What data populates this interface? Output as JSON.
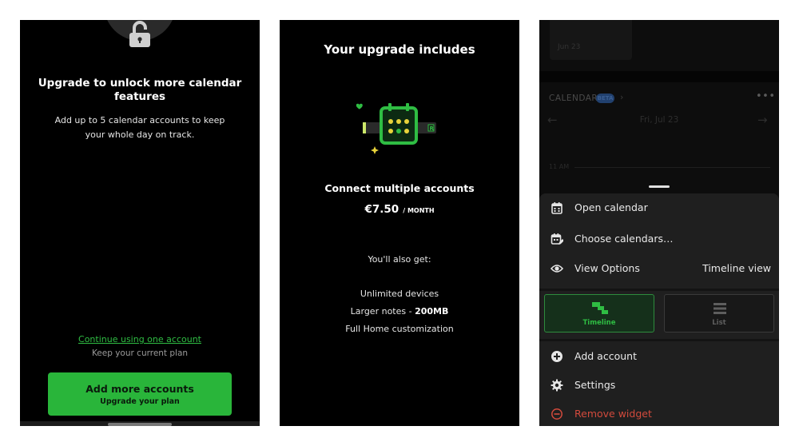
{
  "upgrade_screen": {
    "title": "Upgrade to unlock more calendar features",
    "subtitle": "Add up to 5 calendar accounts to keep your whole day on track.",
    "continue_link": "Continue using one account",
    "keep_plan": "Keep your current plan",
    "cta_label": "Add more accounts",
    "cta_sublabel": "Upgrade your plan",
    "icon": "lock-icon"
  },
  "includes_screen": {
    "title": "Your upgrade includes",
    "feature_title": "Connect multiple accounts",
    "price": "€7.50",
    "price_unit": "/ MONTH",
    "also_get": "You'll also get:",
    "features": [
      {
        "text": "Unlimited devices",
        "bold": ""
      },
      {
        "text": "Larger notes - ",
        "bold": "200MB"
      },
      {
        "text": "Full Home customization",
        "bold": ""
      }
    ],
    "illustration": "calendar-accounts-illustration"
  },
  "widget_screen": {
    "background": {
      "top_card_date": "Jun 23",
      "calendar_label": "CALENDAR",
      "badge": "BETA",
      "date": "Fri, Jul 23",
      "time": "11 AM"
    },
    "menu": {
      "open_calendar": "Open calendar",
      "choose_calendars": "Choose calendars…",
      "view_options": "View Options",
      "view_options_value": "Timeline view",
      "timeline": "Timeline",
      "list": "List",
      "add_account": "Add account",
      "settings": "Settings",
      "remove_widget": "Remove widget"
    }
  },
  "colors": {
    "accent_green": "#29b53a",
    "destructive_red": "#d24a3c",
    "background": "#000000"
  }
}
